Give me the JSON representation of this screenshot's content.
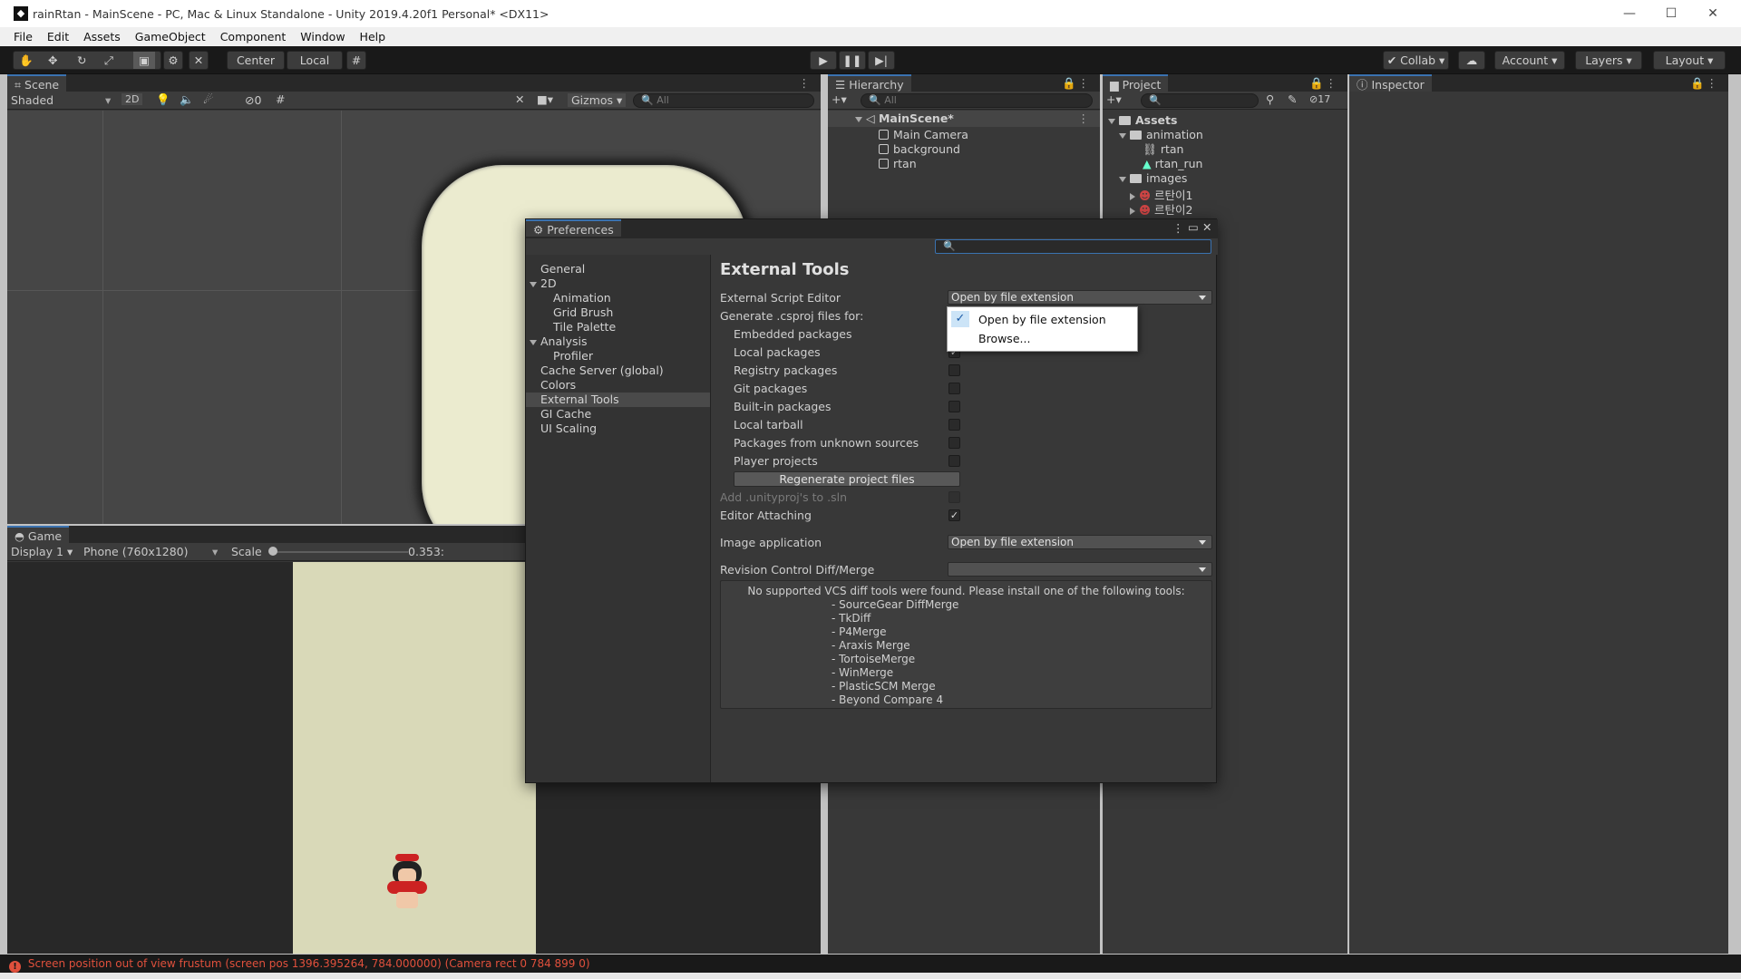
{
  "window": {
    "title": "rainRtan - MainScene - PC, Mac & Linux Standalone - Unity 2019.4.20f1 Personal* <DX11>",
    "min": "—",
    "max": "☐",
    "close": "✕"
  },
  "menu": [
    "File",
    "Edit",
    "Assets",
    "GameObject",
    "Component",
    "Window",
    "Help"
  ],
  "toolbar": {
    "center": "Center",
    "local": "Local",
    "collab": "Collab",
    "account": "Account",
    "layers": "Layers",
    "layout": "Layout"
  },
  "scene": {
    "tab": "Scene",
    "shading": "Shaded",
    "mode2d": "2D",
    "hidden_count": "0",
    "gizmos": "Gizmos",
    "search_placeholder": "All"
  },
  "game": {
    "tab": "Game",
    "display": "Display 1",
    "resolution": "Phone (760x1280)",
    "scale_label": "Scale",
    "scale_value": "0.353:"
  },
  "hierarchy": {
    "tab": "Hierarchy",
    "search_placeholder": "All",
    "scene_name": "MainScene*",
    "items": [
      "Main Camera",
      "background",
      "rtan"
    ]
  },
  "project": {
    "tab": "Project",
    "hidden_count": "17",
    "root": "Assets",
    "animation_folder": "animation",
    "animation_items": [
      "rtan",
      "rtan_run"
    ],
    "images_folder": "images",
    "image_items": [
      "르탄이1",
      "르탄이2"
    ]
  },
  "inspector": {
    "tab": "Inspector"
  },
  "preferences": {
    "tab": "Preferences",
    "nav": {
      "general": "General",
      "twoD": "2D",
      "animation": "Animation",
      "grid_brush": "Grid Brush",
      "tile_palette": "Tile Palette",
      "analysis": "Analysis",
      "profiler": "Profiler",
      "cache_server": "Cache Server (global)",
      "colors": "Colors",
      "external_tools": "External Tools",
      "gi_cache": "GI Cache",
      "ui_scaling": "UI Scaling"
    },
    "heading": "External Tools",
    "script_editor_label": "External Script Editor",
    "script_editor_value": "Open by file extension",
    "csproj_label": "Generate .csproj files for:",
    "csproj_options": [
      {
        "label": "Embedded packages",
        "checked": false
      },
      {
        "label": "Local packages",
        "checked": true
      },
      {
        "label": "Registry packages",
        "checked": false
      },
      {
        "label": "Git packages",
        "checked": false
      },
      {
        "label": "Built-in packages",
        "checked": false
      },
      {
        "label": "Local tarball",
        "checked": false
      },
      {
        "label": "Packages from unknown sources",
        "checked": false
      },
      {
        "label": "Player projects",
        "checked": false
      }
    ],
    "regenerate": "Regenerate project files",
    "add_unityproj": "Add .unityproj's to .sln",
    "editor_attaching": "Editor Attaching",
    "image_app_label": "Image application",
    "image_app_value": "Open by file extension",
    "vcs_label": "Revision Control Diff/Merge",
    "vcs_message": "No supported VCS diff tools were found. Please install one of the following tools:",
    "vcs_tools": [
      "- SourceGear DiffMerge",
      "- TkDiff",
      "- P4Merge",
      "- Araxis Merge",
      "- TortoiseMerge",
      "- WinMerge",
      "- PlasticSCM Merge",
      "- Beyond Compare 4"
    ],
    "dropdown_options": [
      "Open by file extension",
      "Browse..."
    ]
  },
  "status": {
    "message": "Screen position out of view frustum (screen pos 1396.395264, 784.000000) (Camera rect 0 784 899 0)"
  },
  "colors": {
    "accent": "#3a72b0",
    "scene_bg": "#464646",
    "sprite_fill": "#ebebcf",
    "game_bg": "#d9d9b8",
    "error": "#e0503c"
  }
}
